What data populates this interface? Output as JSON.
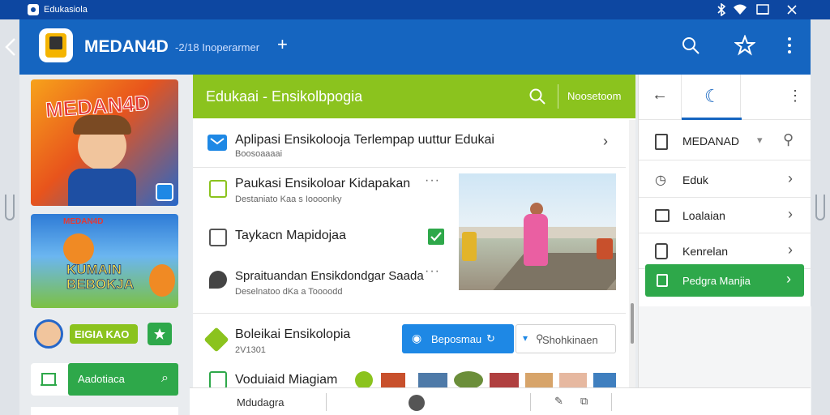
{
  "status_bar": {
    "app_name": "Edukasiola"
  },
  "app_bar": {
    "title": "MEDAN4D",
    "subtitle": "-2/18 Inoperarmer"
  },
  "left_panel": {
    "banner1_text": "MEDAN4D",
    "banner2_top": "MEDAN4D",
    "banner2_text": "KUMAIN BEBOKJA",
    "chip_label": "EIGIA KAO",
    "green_button_label": "Aadotiaca"
  },
  "main": {
    "header_title": "Edukaai - Ensikolbpogia",
    "header_action": "Noosetoom",
    "rows": [
      {
        "title": "Aplipasi Ensikolooja Terlempap uuttur Edukai",
        "sub": "Boosoaaaai"
      },
      {
        "title": "Paukasi Ensikoloar Kidapakan",
        "sub": "Destaniato Kaa s Ioooonky"
      },
      {
        "title": "Taykacn Mapidojaa",
        "sub": ""
      },
      {
        "title": "Spraituandan Ensikdondgar Saada",
        "sub": "Deselnatoo dKa a Toooodd"
      },
      {
        "title": "Boleikai Ensikolopia",
        "sub": "2V1301"
      },
      {
        "title": "Voduiaid Miagiam",
        "sub": ""
      }
    ],
    "primary_button": "Beposmau",
    "secondary_button": "Shohkinaen"
  },
  "right_panel": {
    "dropdown_label": "MEDANAD",
    "items": [
      "Eduk",
      "Loalaian",
      "Kenrelan"
    ],
    "active_item": "Pedgra Manjia"
  },
  "bottom_bar": {
    "label": "Mdudagra"
  },
  "colors": {
    "status": "#0d47a1",
    "appbar": "#1565c0",
    "accent_green": "#8bc31e",
    "button_green": "#2ea84a",
    "button_blue": "#1e88e5"
  }
}
